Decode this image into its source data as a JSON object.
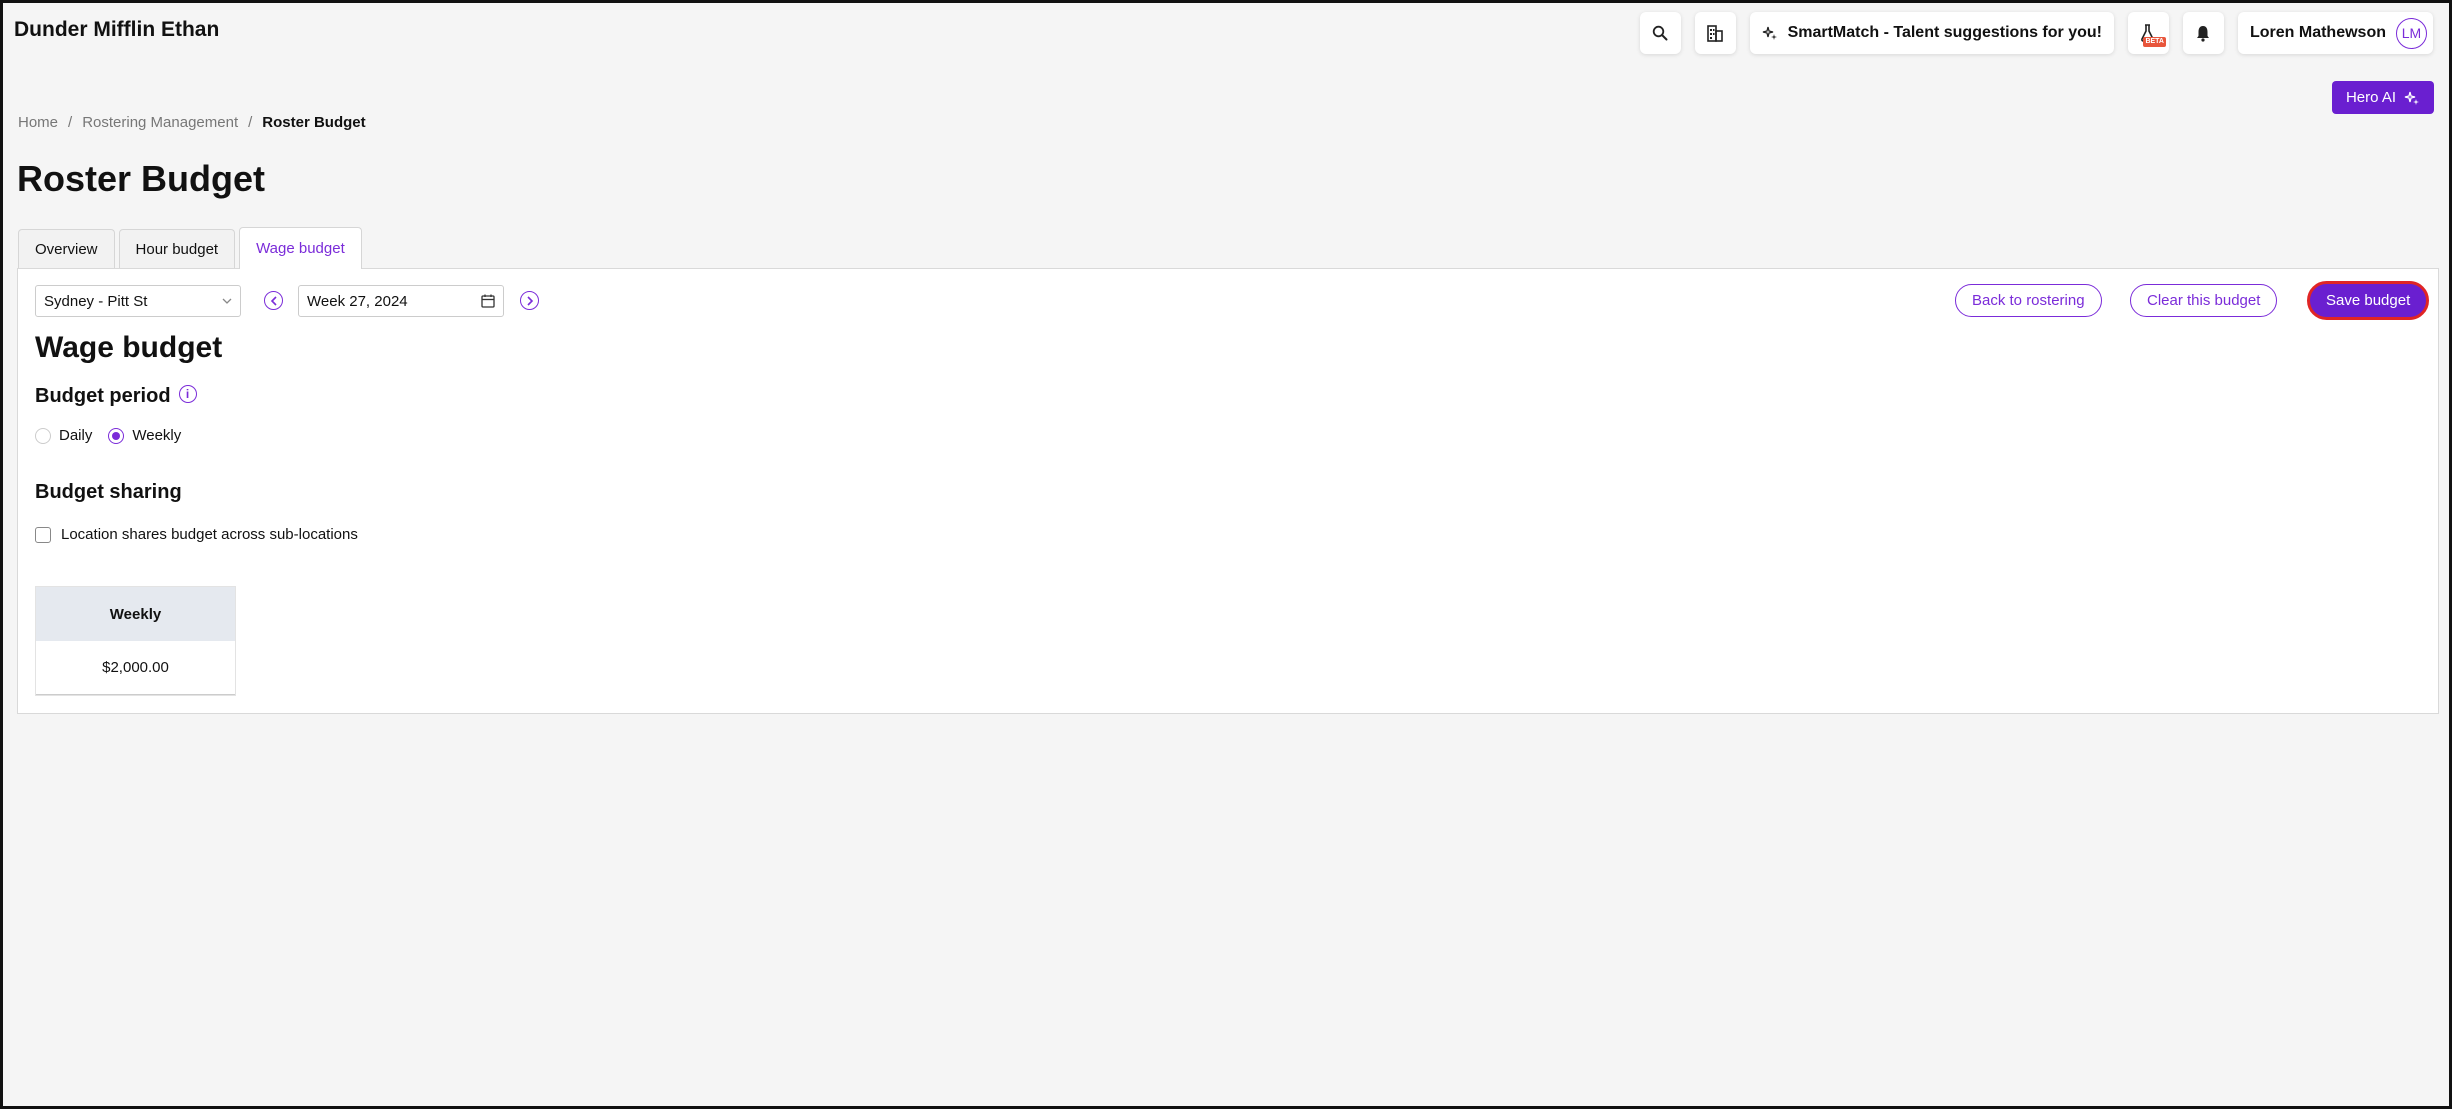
{
  "header": {
    "company": "Dunder Mifflin Ethan",
    "smartmatch_label": "SmartMatch - Talent suggestions for you!",
    "beta_badge": "BETA",
    "user_name": "Loren Mathewson",
    "user_initials": "LM",
    "hero_ai_label": "Hero AI"
  },
  "breadcrumb": {
    "home": "Home",
    "separator": "/",
    "section": "Rostering Management",
    "current": "Roster Budget"
  },
  "page_title": "Roster Budget",
  "tabs": [
    {
      "label": "Overview",
      "active": false
    },
    {
      "label": "Hour budget",
      "active": false
    },
    {
      "label": "Wage budget",
      "active": true
    }
  ],
  "toolbar": {
    "location": "Sydney - Pitt St",
    "week": "Week 27, 2024",
    "back_label": "Back to rostering",
    "clear_label": "Clear this budget",
    "save_label": "Save budget"
  },
  "wage_budget": {
    "title": "Wage budget",
    "period_title": "Budget period",
    "period_options": [
      "Daily",
      "Weekly"
    ],
    "period_selected": "Weekly",
    "sharing_title": "Budget sharing",
    "sharing_checkbox_label": "Location shares budget across sub-locations",
    "sharing_checked": false,
    "table_header": "Weekly",
    "table_value": "$2,000.00"
  },
  "colors": {
    "accent": "#7b2cd9",
    "primary_button": "#6a1fd0",
    "focus_ring": "#e02525",
    "background": "#f5f5f5"
  },
  "icons": [
    "search-icon",
    "building-icon",
    "sparkle-icon",
    "flask-icon",
    "bell-icon",
    "info-icon",
    "calendar-icon",
    "chevron-down-icon",
    "chevron-left-icon",
    "chevron-right-icon"
  ]
}
